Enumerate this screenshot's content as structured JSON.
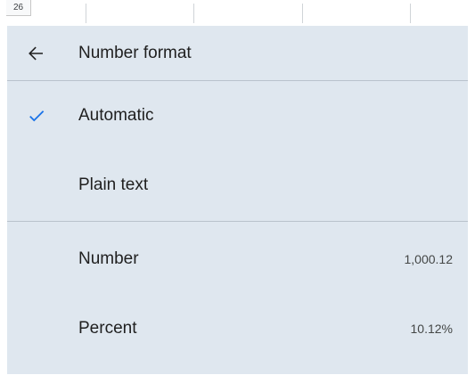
{
  "spreadsheet": {
    "row_number": "26"
  },
  "menu": {
    "title": "Number format",
    "back_icon": "arrow-left-icon",
    "check_icon": "checkmark-icon",
    "accent_color": "#1a73e8",
    "items": [
      {
        "label": "Automatic",
        "value": "",
        "selected": true
      },
      {
        "label": "Plain text",
        "value": "",
        "selected": false
      },
      {
        "label": "Number",
        "value": "1,000.12",
        "selected": false
      },
      {
        "label": "Percent",
        "value": "10.12%",
        "selected": false
      }
    ]
  }
}
